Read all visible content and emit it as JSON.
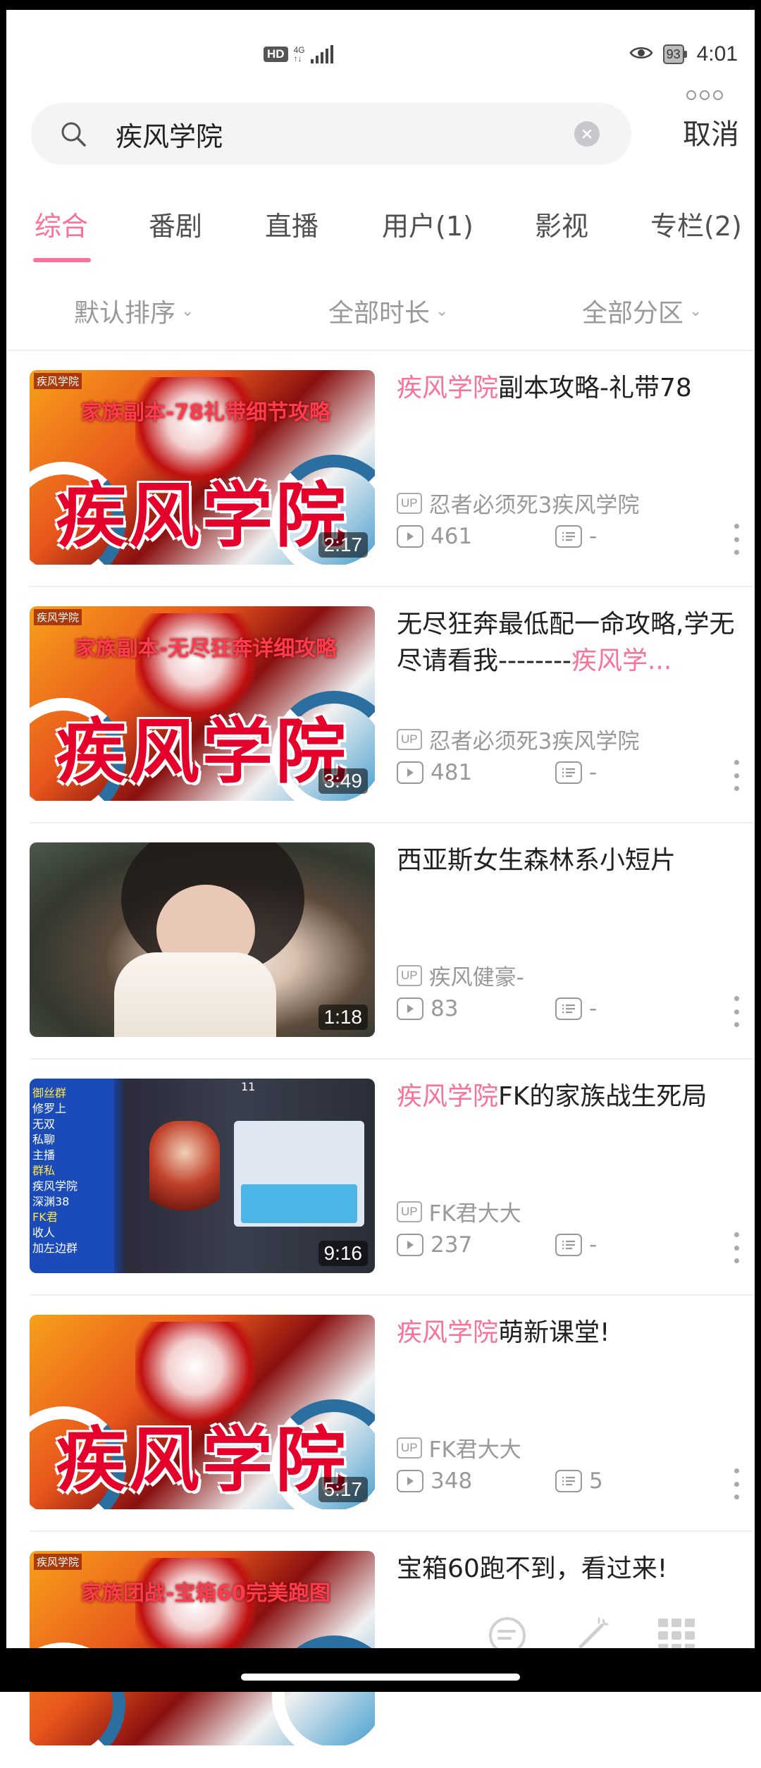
{
  "status_bar": {
    "hd": "HD",
    "network": "4G",
    "battery": "93",
    "time": "4:01"
  },
  "search": {
    "query": "疾风学院",
    "cancel_label": "取消"
  },
  "tabs": [
    {
      "label": "综合",
      "active": true
    },
    {
      "label": "番剧",
      "active": false
    },
    {
      "label": "直播",
      "active": false
    },
    {
      "label": "用户(1)",
      "active": false
    },
    {
      "label": "影视",
      "active": false
    },
    {
      "label": "专栏(2)",
      "active": false
    }
  ],
  "filters": [
    {
      "label": "默认排序"
    },
    {
      "label": "全部时长"
    },
    {
      "label": "全部分区"
    }
  ],
  "results": [
    {
      "title_highlight": "疾风学院",
      "title_rest": "副本攻略-礼带78",
      "thumb_overlay": "家族副本-78礼带细节攻略",
      "thumb_big": "疾风学院",
      "thumb_corner": "疾风学院",
      "duration": "2:17",
      "up_badge": "UP",
      "uploader": "忍者必须死3疾风学院",
      "views": "461",
      "danmaku": "-"
    },
    {
      "title_prefix": "无尽狂奔最低配一命攻略,学无尽请看我--------",
      "title_highlight": "疾风学...",
      "thumb_overlay": "家族副本-无尽狂奔详细攻略",
      "thumb_big": "疾风学院",
      "thumb_corner": "疾风学院",
      "duration": "3:49",
      "up_badge": "UP",
      "uploader": "忍者必须死3疾风学院",
      "views": "481",
      "danmaku": "-"
    },
    {
      "title_rest": "西亚斯女生森林系小短片",
      "duration": "1:18",
      "up_badge": "UP",
      "uploader": "疾风健豪-",
      "views": "83",
      "danmaku": "-"
    },
    {
      "title_highlight": "疾风学院",
      "title_rest": "FK的家族战生死局",
      "duration": "9:16",
      "thumb_top_number": "11",
      "thumb_side_lines": [
        "御丝群",
        "修罗上",
        "无双",
        "私聊",
        "主播",
        "群私",
        "疾风学院",
        "深渊38",
        "FK君",
        "收人",
        "加左边群"
      ],
      "up_badge": "UP",
      "uploader": "FK君大大",
      "views": "237",
      "danmaku": "-"
    },
    {
      "title_highlight": "疾风学院",
      "title_rest": "萌新课堂!",
      "thumb_big": "疾风学院",
      "duration": "5:17",
      "up_badge": "UP",
      "uploader": "FK君大大",
      "views": "348",
      "danmaku": "5"
    },
    {
      "title_rest": "宝箱60跑不到，看过来!",
      "thumb_overlay": "家族团战-宝箱60完美跑图",
      "thumb_corner": "疾风学院"
    }
  ],
  "colors": {
    "accent": "#fb7299",
    "text": "#212121",
    "muted": "#999999"
  },
  "icons": [
    "search-icon",
    "clear-icon",
    "chevron-down-icon",
    "play-icon",
    "danmaku-icon",
    "more-icon",
    "eye-icon",
    "signal-icon",
    "battery-icon"
  ]
}
